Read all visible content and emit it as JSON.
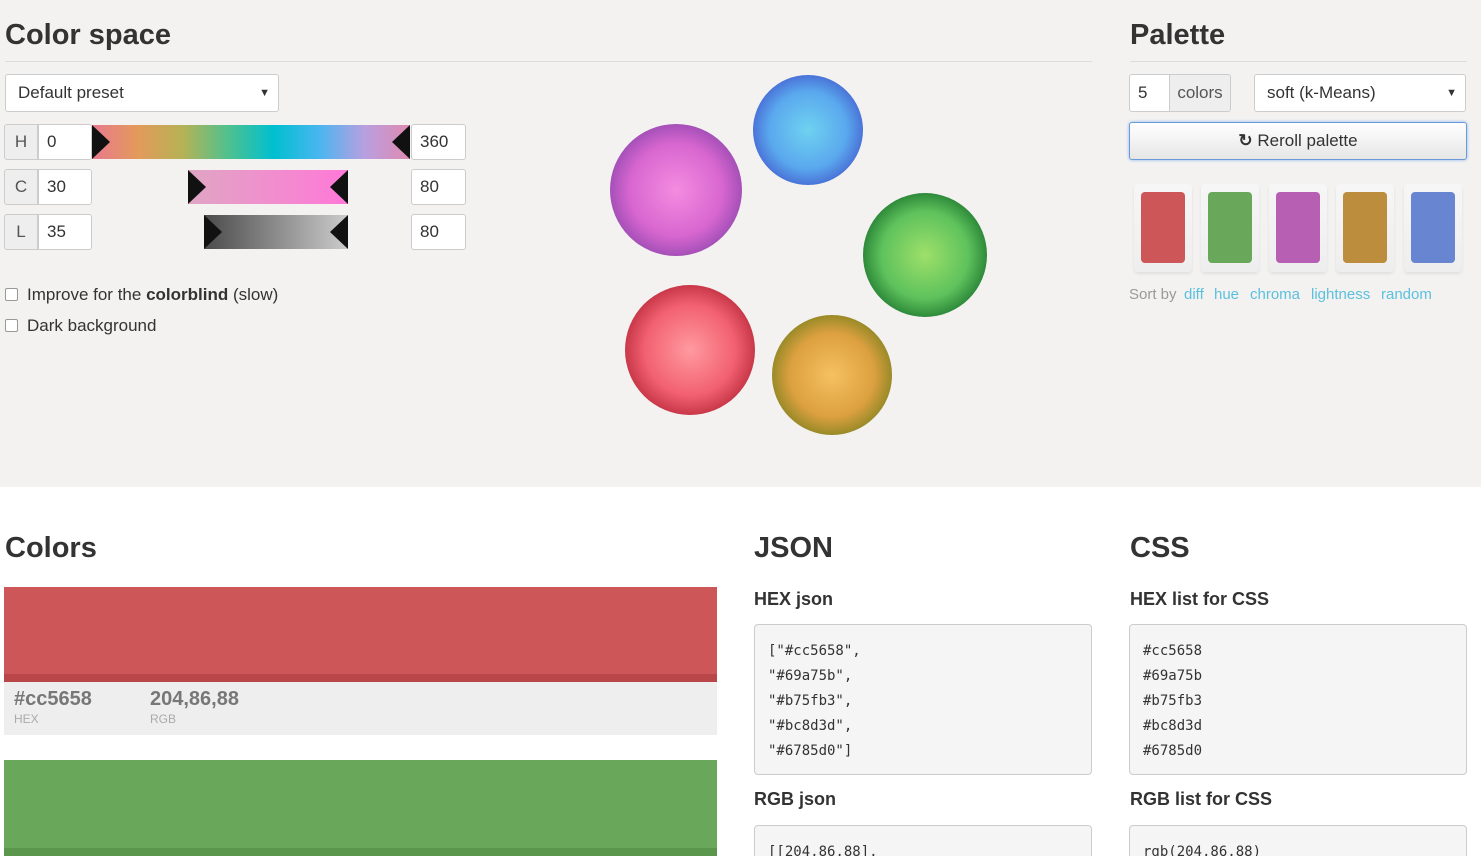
{
  "color_space": {
    "title": "Color space",
    "preset": "Default preset",
    "h": {
      "label": "H",
      "min": "0",
      "max": "360"
    },
    "c": {
      "label": "C",
      "min": "30",
      "max": "80"
    },
    "l": {
      "label": "L",
      "min": "35",
      "max": "80"
    },
    "colorblind_pre": "Improve for the ",
    "colorblind_bold": "colorblind",
    "colorblind_post": " (slow)",
    "dark_background": "Dark background"
  },
  "palette": {
    "title": "Palette",
    "count": "5",
    "count_unit": "colors",
    "mode": "soft (k-Means)",
    "reroll": "Reroll palette",
    "swatches": [
      "#cc5658",
      "#69a75b",
      "#b75fb3",
      "#bc8d3d",
      "#6785d0"
    ],
    "sort_by": "Sort by",
    "sort_options": [
      "diff",
      "hue",
      "chroma",
      "lightness",
      "random"
    ]
  },
  "colors": {
    "title": "Colors",
    "items": [
      {
        "hex": "#cc5658",
        "rgb": "204,86,88",
        "hex_label": "HEX",
        "rgb_label": "RGB"
      }
    ]
  },
  "json": {
    "title": "JSON",
    "hex_title": "HEX json",
    "hex_lines": [
      "[\"#cc5658\",",
      "\"#69a75b\",",
      "\"#b75fb3\",",
      "\"#bc8d3d\",",
      "\"#6785d0\"]"
    ],
    "rgb_title": "RGB json",
    "rgb_lines": [
      "[[204,86,88],"
    ]
  },
  "css": {
    "title": "CSS",
    "hex_title": "HEX list for CSS",
    "hex_lines": [
      "#cc5658",
      "#69a75b",
      "#b75fb3",
      "#bc8d3d",
      "#6785d0"
    ],
    "rgb_title": "RGB list for CSS",
    "rgb_lines": [
      "rgb(204,86,88)"
    ]
  }
}
